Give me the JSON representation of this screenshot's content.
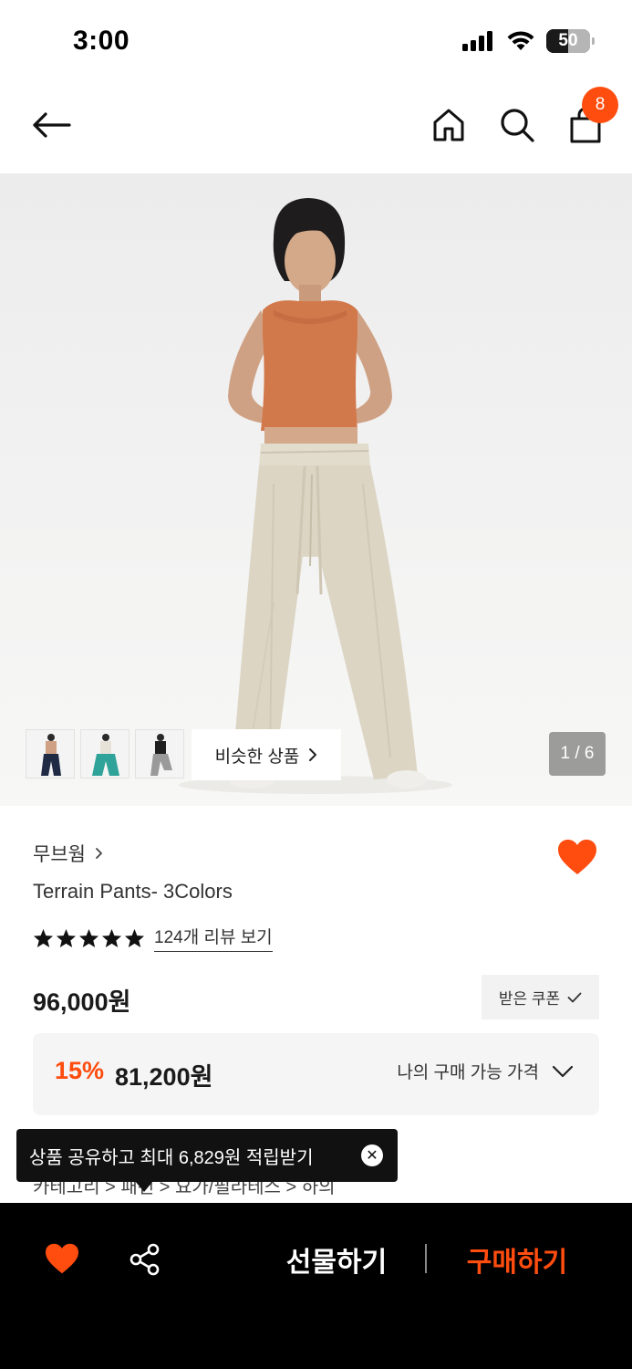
{
  "status_bar": {
    "time": "3:00",
    "battery": "50",
    "battery_level": 0.5
  },
  "header": {
    "back_icon": "arrow-left-icon",
    "home_icon": "home-icon",
    "search_icon": "search-icon",
    "cart_icon": "shopping-bag-icon",
    "cart_count": "8"
  },
  "gallery": {
    "similar_label": "비슷한 상품",
    "page_indicator": "1 / 6",
    "current_page": 1,
    "total_pages": 6,
    "thumbnails": [
      "navy-pants",
      "teal-pants",
      "gray-pants"
    ]
  },
  "product": {
    "brand": "무브웜",
    "name": "Terrain Pants- 3Colors",
    "rating_stars": 5,
    "review_link": "124개 리뷰 보기",
    "price": "96,000원",
    "coupon_label": "받은 쿠폰",
    "discount_rate": "15%",
    "discount_price": "81,200원",
    "my_price_label": "나의 구매 가능 가격"
  },
  "breadcrumb": "카테고리  >  패션  >  요가/필라테스  >  하의",
  "tooltip": {
    "text": "상품 공유하고 최대 6,829원 적립받기",
    "close": "✕"
  },
  "bottom_bar": {
    "gift_label": "선물하기",
    "buy_label": "구매하기"
  },
  "colors": {
    "accent": "#ff4c0f",
    "bar_bg": "#000000",
    "price_box_bg": "#f5f5f5"
  }
}
